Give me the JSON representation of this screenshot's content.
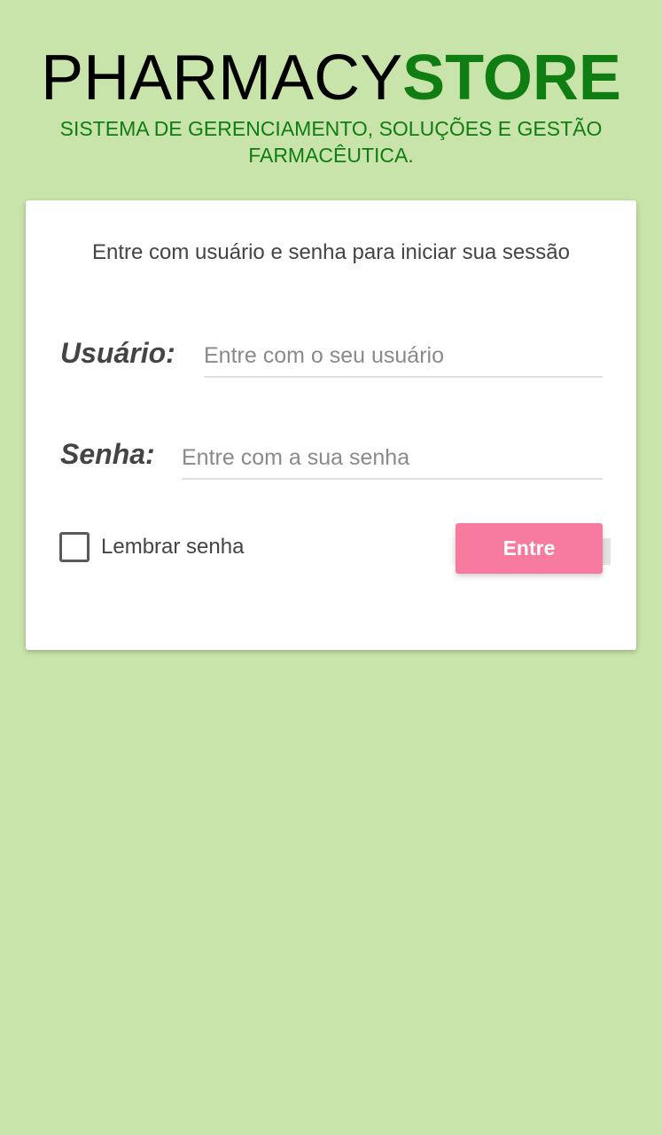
{
  "brand": {
    "logo_part1": "PHARMACY",
    "logo_part2": "STORE",
    "tagline": "SISTEMA DE GERENCIAMENTO, SOLUÇÕES E GESTÃO FARMACÊUTICA."
  },
  "login": {
    "intro": "Entre com usuário e senha para iniciar sua sessão",
    "user_label": "Usuário:",
    "user_placeholder": "Entre com o seu usuário",
    "user_value": "",
    "pass_label": "Senha:",
    "pass_placeholder": "Entre com a sua senha",
    "pass_value": "",
    "remember_label": "Lembrar senha",
    "remember_checked": false,
    "submit_label": "Entre"
  },
  "colors": {
    "background": "#c8e4aa",
    "brand_green": "#0f7d12",
    "button_pink": "#f77b9e"
  }
}
